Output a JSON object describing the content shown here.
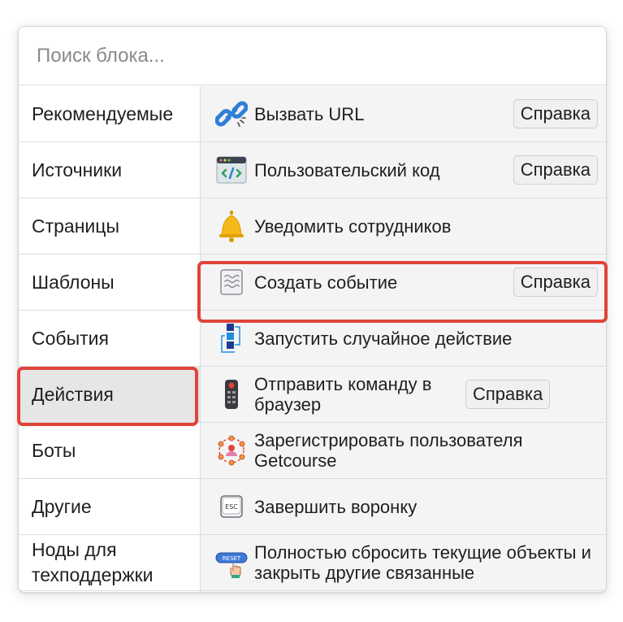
{
  "search": {
    "placeholder": "Поиск блока..."
  },
  "sidebar": {
    "items": [
      {
        "label": "Рекомендуемые"
      },
      {
        "label": "Источники"
      },
      {
        "label": "Страницы"
      },
      {
        "label": "Шаблоны"
      },
      {
        "label": "События"
      },
      {
        "label": "Действия",
        "active": true
      },
      {
        "label": "Боты"
      },
      {
        "label": "Другие"
      },
      {
        "label": "Ноды для техподдержки"
      }
    ]
  },
  "actions": {
    "help_label": "Справка",
    "items": [
      {
        "label": "Вызвать URL",
        "icon": "link-icon",
        "help": true
      },
      {
        "label": "Пользовательский код",
        "icon": "code-window-icon",
        "help": true
      },
      {
        "label": "Уведомить сотрудников",
        "icon": "bell-icon",
        "help": false
      },
      {
        "label": "Создать событие",
        "icon": "event-waves-icon",
        "help": true
      },
      {
        "label": "Запустить случайное действие",
        "icon": "random-blocks-icon",
        "help": false
      },
      {
        "label": "Отправить команду в браузер",
        "icon": "remote-control-icon",
        "help": true
      },
      {
        "label": "Зарегистрировать пользователя Getcourse",
        "icon": "user-network-icon",
        "help": false
      },
      {
        "label": "Завершить воронку",
        "icon": "esc-key-icon",
        "help": false
      },
      {
        "label": "Полностью сбросить текущие объекты и закрыть другие связанные",
        "icon": "reset-button-icon",
        "help": false
      }
    ]
  },
  "colors": {
    "highlight": "#e0443a",
    "active_bg": "#e6e6e6",
    "content_bg": "#f4f4f5"
  }
}
